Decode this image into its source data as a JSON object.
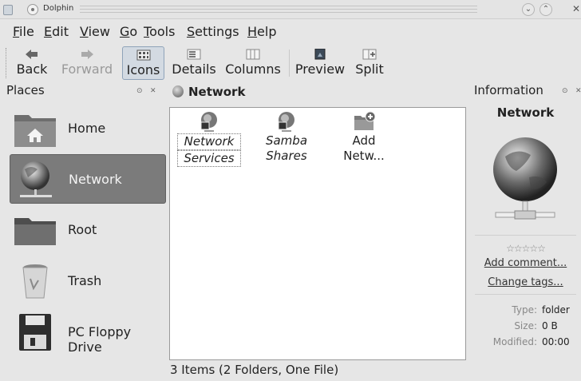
{
  "window": {
    "title": "Dolphin"
  },
  "menubar": [
    {
      "u": "F",
      "rest": "ile"
    },
    {
      "u": "E",
      "rest": "dit"
    },
    {
      "u": "V",
      "rest": "iew"
    },
    {
      "u": "G",
      "rest": "o"
    },
    {
      "pre": "",
      "u": "T",
      "rest": "ools"
    },
    {
      "u": "S",
      "rest": "ettings"
    },
    {
      "u": "H",
      "rest": "elp"
    }
  ],
  "toolbar": {
    "back": "Back",
    "forward": "Forward",
    "icons": "Icons",
    "details": "Details",
    "columns": "Columns",
    "preview": "Preview",
    "split": "Split"
  },
  "places": {
    "title": "Places",
    "items": [
      {
        "label": "Home",
        "icon": "home-folder-icon"
      },
      {
        "label": "Network",
        "icon": "network-globe-icon",
        "selected": true
      },
      {
        "label": "Root",
        "icon": "folder-icon"
      },
      {
        "label": "Trash",
        "icon": "trash-icon"
      },
      {
        "label": "PC Floppy Drive",
        "icon": "floppy-icon"
      }
    ]
  },
  "view": {
    "location": "Network",
    "items": [
      {
        "name1": "Network",
        "name2": "Services",
        "icon": "network-service-icon"
      },
      {
        "name1": "Samba",
        "name2": "Shares",
        "icon": "network-service-icon"
      },
      {
        "name1": "Add",
        "name2": "Netw...",
        "icon": "add-folder-icon"
      }
    ],
    "status": "3 Items (2 Folders, One File)"
  },
  "info": {
    "title": "Information",
    "name": "Network",
    "stars": "☆☆☆☆☆",
    "add_comment": "Add comment...",
    "change_tags": "Change tags...",
    "type_label": "Type:",
    "type_value": "folder",
    "size_label": "Size:",
    "size_value": "0 B",
    "modified_label": "Modified:",
    "modified_value": "00:00"
  }
}
